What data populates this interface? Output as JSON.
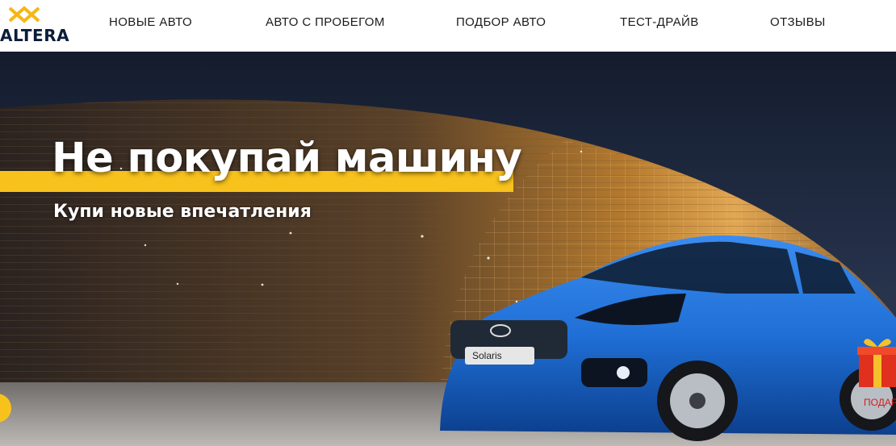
{
  "header": {
    "logo_text": "ALTERA",
    "nav": [
      {
        "label": "НОВЫЕ АВТО"
      },
      {
        "label": "АВТО С ПРОБЕГОМ"
      },
      {
        "label": "ПОДБОР АВТО"
      },
      {
        "label": "ТЕСТ-ДРАЙВ"
      },
      {
        "label": "ОТЗЫВЫ"
      }
    ]
  },
  "hero": {
    "headline": "Не покупай машину",
    "subheadline": "Купи новые впечатления",
    "car_badge": "Solaris",
    "gift_label": "ПОДАРОК"
  },
  "colors": {
    "accent": "#f7c21c",
    "car": "#1f6fd6",
    "header_bg": "#ffffff",
    "nav_text": "#1b1b1b",
    "logo_text": "#0b1d3a"
  },
  "icons": {
    "logo_mark": "altera-diamond-mark",
    "scroll": "scroll-circle-icon",
    "gift": "gift-box-icon"
  }
}
